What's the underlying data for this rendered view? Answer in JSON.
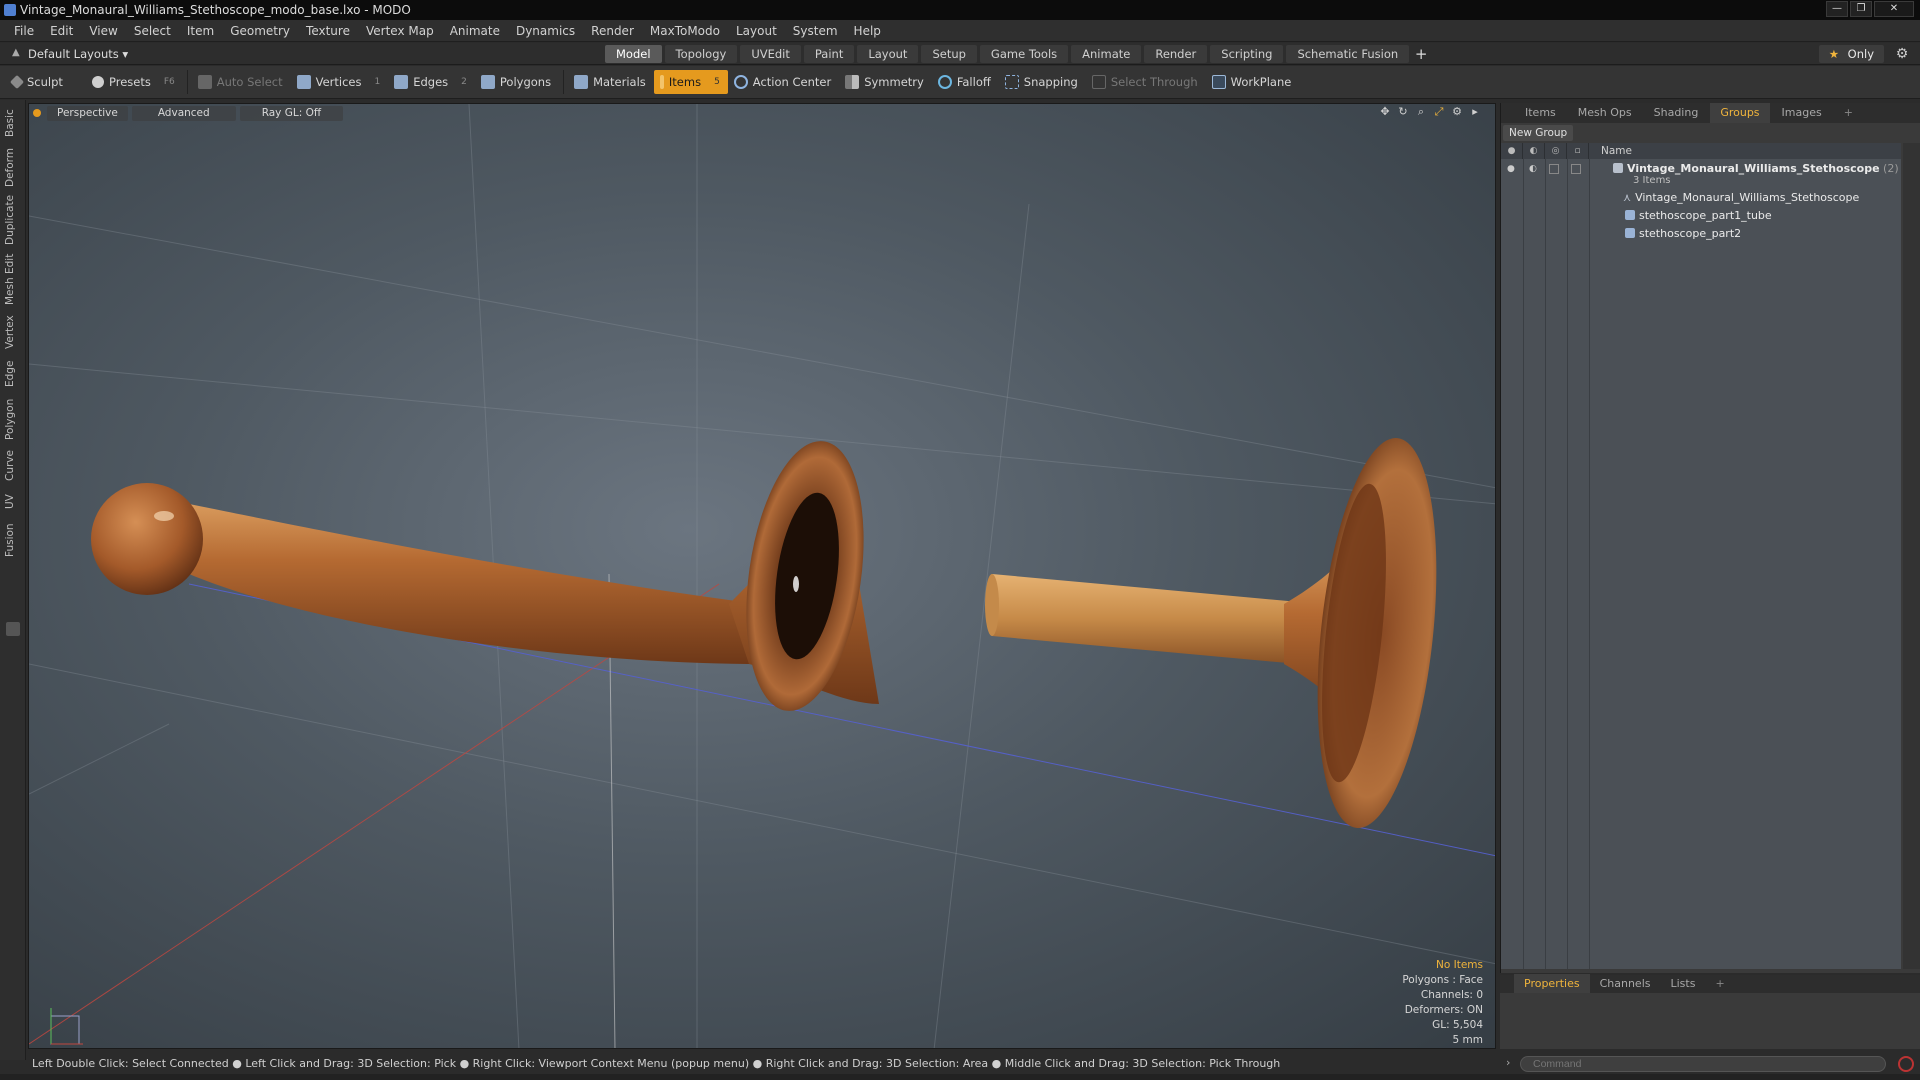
{
  "window": {
    "title": "Vintage_Monaural_Williams_Stethoscope_modo_base.lxo - MODO",
    "minimize": "—",
    "restore": "❐",
    "close": "✕"
  },
  "menu": [
    "File",
    "Edit",
    "View",
    "Select",
    "Item",
    "Geometry",
    "Texture",
    "Vertex Map",
    "Animate",
    "Dynamics",
    "Render",
    "MaxToModo",
    "Layout",
    "System",
    "Help"
  ],
  "layout_dropdown": "Default Layouts ▾",
  "mode_tabs": [
    "Model",
    "Topology",
    "UVEdit",
    "Paint",
    "Layout",
    "Setup",
    "Game Tools",
    "Animate",
    "Render",
    "Scripting",
    "Schematic Fusion"
  ],
  "mode_add": "+",
  "only_button": "Only",
  "toolbar": {
    "sculpt": "Sculpt",
    "presets": "Presets",
    "presets_key": "F6",
    "auto_select": "Auto Select",
    "vertices": "Vertices",
    "vertices_num": "1",
    "edges": "Edges",
    "edges_num": "2",
    "polygons": "Polygons",
    "materials": "Materials",
    "items": "Items",
    "items_num": "5",
    "action_center": "Action Center",
    "symmetry": "Symmetry",
    "falloff": "Falloff",
    "snapping": "Snapping",
    "select_through": "Select Through",
    "workplane": "WorkPlane"
  },
  "left_tabs": [
    "Basic",
    "Deform",
    "Duplicate",
    "Mesh Edit",
    "Vertex",
    "Edge",
    "Polygon",
    "Curve",
    "UV",
    "Fusion"
  ],
  "viewport": {
    "view": "Perspective",
    "shading": "Advanced",
    "raygl": "Ray GL: Off",
    "info": {
      "selection": "No Items",
      "polygons": "Polygons : Face",
      "channels": "Channels: 0",
      "deformers": "Deformers: ON",
      "gl": "GL: 5,504",
      "unit": "5 mm"
    }
  },
  "status_bar": "Left Double Click: Select Connected ● Left Click and Drag: 3D Selection: Pick ● Right Click: Viewport Context Menu (popup menu) ● Right Click and Drag: 3D Selection: Area ● Middle Click and Drag: 3D Selection: Pick Through",
  "right_panel": {
    "tabs": [
      "Items",
      "Mesh Ops",
      "Shading",
      "Groups",
      "Images"
    ],
    "active_tab": "Groups",
    "tab_add": "+",
    "new_group": "New Group",
    "column_name": "Name",
    "group": {
      "name": "Vintage_Monaural_Williams_Stethoscope",
      "count": "(2)",
      "items_label": "3 Items"
    },
    "children": [
      "Vintage_Monaural_Williams_Stethoscope",
      "stethoscope_part1_tube",
      "stethoscope_part2"
    ]
  },
  "bottom_panel": {
    "tabs": [
      "Properties",
      "Channels",
      "Lists"
    ],
    "tab_add": "+",
    "command_placeholder": "Command"
  },
  "colors": {
    "accent": "#e59a1e",
    "active_tab_text": "#f0b43c",
    "wood": "#a0522d"
  }
}
